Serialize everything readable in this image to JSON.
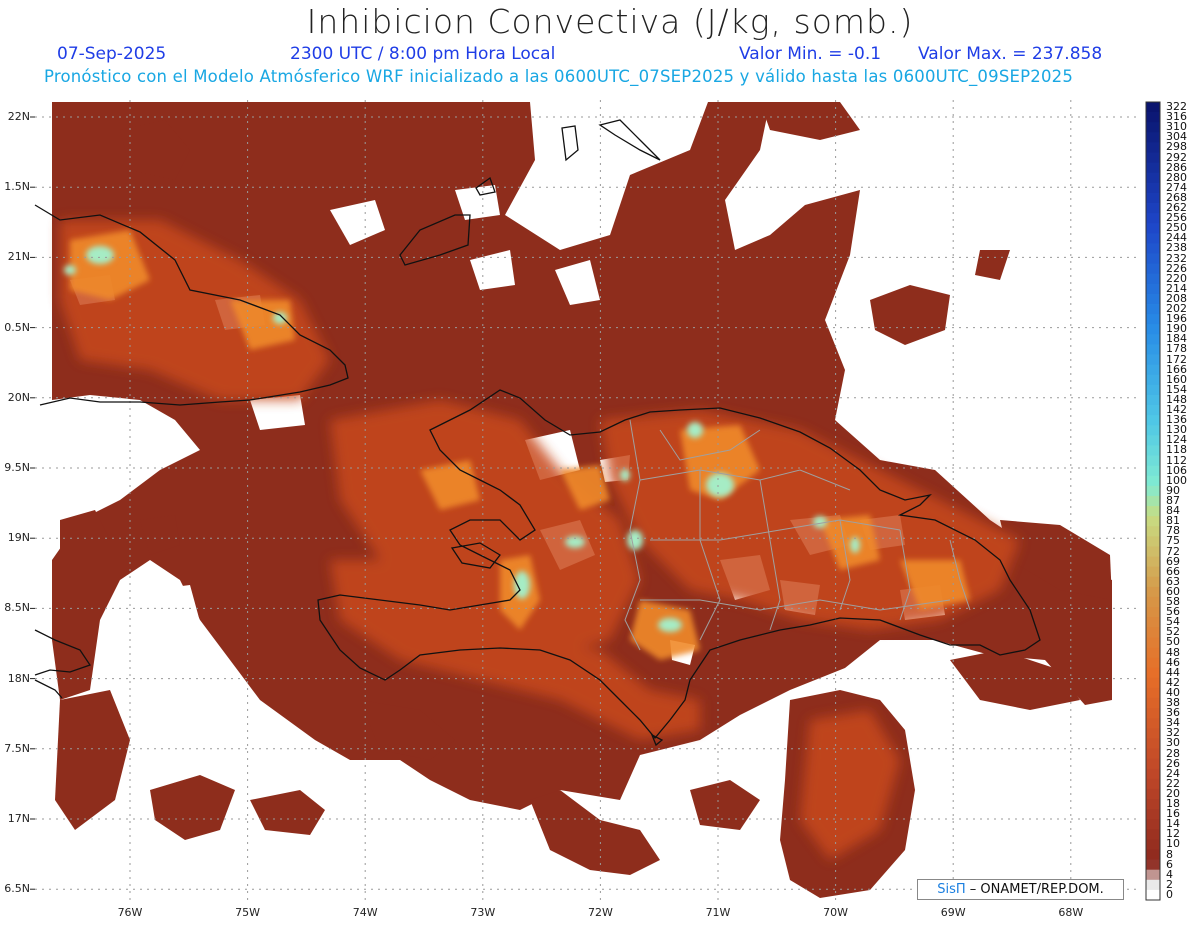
{
  "header": {
    "title": "Inhibicion Convectiva (J/kg, somb.)",
    "date": "07-Sep-2025",
    "time": "2300 UTC / 8:00 pm Hora Local",
    "min_label": "Valor Min. = -0.1",
    "max_label": "Valor Max. = 237.858",
    "model_line": "Pronóstico con el Modelo Atmósferico WRF inicializado a las 0600UTC_07SEP2025 y válido hasta las  0600UTC_09SEP2025"
  },
  "map": {
    "y_axis_labels": [
      "22N",
      "1.5N",
      "21N",
      "0.5N",
      "20N",
      "9.5N",
      "19N",
      "8.5N",
      "18N",
      "7.5N",
      "17N",
      "6.5N"
    ],
    "x_axis_labels": [
      "76W",
      "75W",
      "74W",
      "73W",
      "72W",
      "71W",
      "70W",
      "69W",
      "68W"
    ],
    "colors": {
      "land_outline": "#111111",
      "province_lines": "#a0a0a0",
      "field_base": "#8e2d1c",
      "field_mid": "#c84a1e",
      "field_high": "#f08a2a",
      "field_peak": "#9be8c8",
      "grid": "#9a9a9a"
    }
  },
  "colorbar": {
    "labels": [
      "322",
      "316",
      "310",
      "304",
      "298",
      "292",
      "286",
      "280",
      "274",
      "268",
      "262",
      "256",
      "250",
      "244",
      "238",
      "232",
      "226",
      "220",
      "214",
      "208",
      "202",
      "196",
      "190",
      "184",
      "178",
      "172",
      "166",
      "160",
      "154",
      "148",
      "142",
      "136",
      "130",
      "124",
      "118",
      "112",
      "106",
      "100",
      "90",
      "87",
      "84",
      "81",
      "78",
      "75",
      "72",
      "69",
      "66",
      "63",
      "60",
      "58",
      "56",
      "54",
      "52",
      "50",
      "48",
      "46",
      "44",
      "42",
      "40",
      "38",
      "36",
      "34",
      "32",
      "30",
      "28",
      "26",
      "24",
      "22",
      "20",
      "18",
      "16",
      "14",
      "12",
      "10",
      "8",
      "6",
      "4",
      "2",
      "0"
    ]
  },
  "credit": {
    "sis": "SisΠ",
    "rest": " – ONAMET/REP.DOM."
  }
}
